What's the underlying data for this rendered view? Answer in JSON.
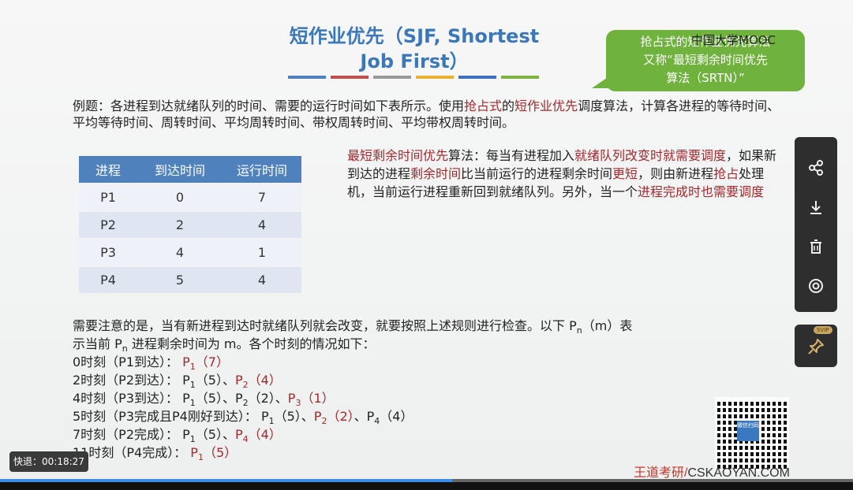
{
  "title": {
    "line1": "短作业优先（SJF, Shortest",
    "line2": "Job First）",
    "bar_colors": [
      "#4f81bd",
      "#c0504d",
      "#9a9a9a",
      "#e8b32e",
      "#3f6fbf",
      "#7cb341"
    ]
  },
  "bubble": {
    "line1": "抢占式的短作业优先算法",
    "line2": "又称“最短剩余时间优先",
    "line3": "算法（SRTN）”"
  },
  "watermark": "中国大学MOOC",
  "intro": {
    "p1": "例题：各进程到达就绪队列的时间、需要的运行时间如下表所示。使用",
    "r1": "抢占式",
    "p2": "的",
    "r2": "短作业优先",
    "p3": "调度算法，计算各进程的等待时间、平均等待时间、周转时间、平均周转时间、带权周转时间、平均带权周转时间。"
  },
  "table": {
    "headers": [
      "进程",
      "到达时间",
      "运行时间"
    ],
    "rows": [
      [
        "P1",
        "0",
        "7"
      ],
      [
        "P2",
        "2",
        "4"
      ],
      [
        "P3",
        "4",
        "1"
      ],
      [
        "P4",
        "5",
        "4"
      ]
    ]
  },
  "note": {
    "r1": "最短剩余时间优先",
    "p1": "算法：每当有进程加入",
    "r2": "就绪队列改变时就需要调度",
    "p2": "，如果新到达的进程",
    "r3": "剩余时间",
    "p3": "比当前运行的进程剩余时间",
    "r4": "更短",
    "p4": "，则由新进程",
    "r5": "抢占",
    "p5": "处理机，当前运行进程重新回到就绪队列。另外，当一个",
    "r6": "进程完成时也需要调度"
  },
  "lines": {
    "l1": "需要注意的是，当有新进程到达时就绪队列就会改变，就要按照上述规则进行检查。以下 P",
    "l1_sub": "n",
    "l1_end": "（m）表",
    "l2a": "示当前 P",
    "l2_sub": "n",
    "l2b": " 进程剩余时间为 m。各个时刻的情况如下：",
    "t0": "0时刻（P1到达）：",
    "t0v": "P",
    "t2": "2时刻（P2到达）：",
    "t4": "4时刻（P3到达）：",
    "t5": "5时刻（P3完成且P4刚好到达）：",
    "t7": "7时刻（P2完成）：",
    "t11": "11时刻（P4完成）："
  },
  "brand": {
    "red": "王道考研/",
    "dark": "CSKAOYAN.COM"
  },
  "qr_label": "微信扫码",
  "sidebar": {
    "share": "share-icon",
    "download": "download-icon",
    "delete": "trash-icon",
    "record": "record-icon"
  },
  "svip": "SVIP",
  "speed": {
    "label": "快退：",
    "time": "00:18:27"
  },
  "progress": {
    "fraction": 0.53
  }
}
